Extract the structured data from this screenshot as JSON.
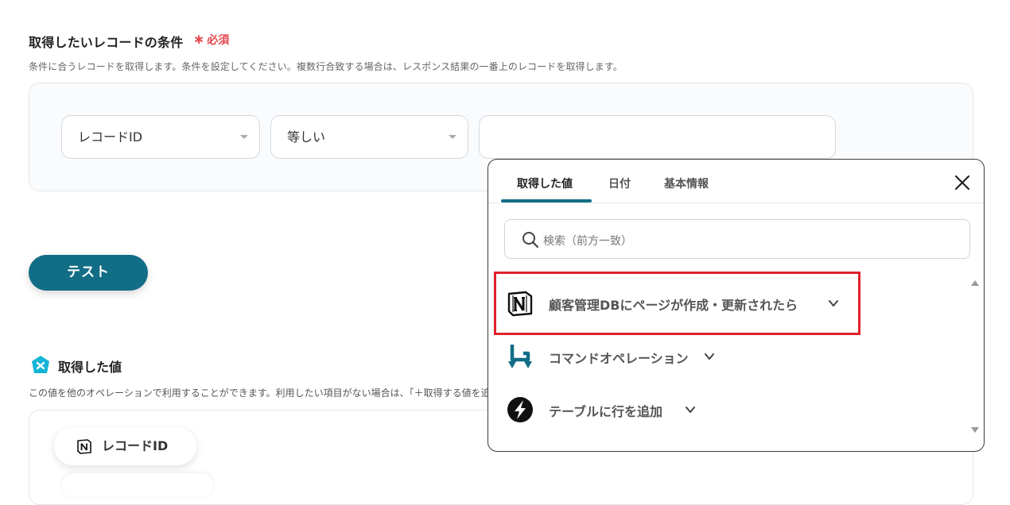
{
  "condition_section": {
    "title": "取得したいレコードの条件",
    "required_label": "必須",
    "description": "条件に合うレコードを取得します。条件を設定してください。複数行合致する場合は、レスポンス結果の一番上のレコードを取得します。",
    "field_select": "レコードID",
    "operator_select": "等しい",
    "value_input": ""
  },
  "test_button": "テスト",
  "value_section": {
    "title": "取得した値",
    "description": "この値を他のオペレーションで利用することができます。利用したい項目がない場合は、「＋取得する値を追加」から追加してください。",
    "chip_label": "レコードID"
  },
  "popup": {
    "tabs": [
      {
        "label": "取得した値",
        "active": true
      },
      {
        "label": "日付",
        "active": false
      },
      {
        "label": "基本情報",
        "active": false
      }
    ],
    "search_placeholder": "検索（前方一致）",
    "items": [
      {
        "label": "顧客管理DBにページが作成・更新されたら",
        "icon": "notion-icon",
        "highlighted": true
      },
      {
        "label": "コマンドオペレーション",
        "icon": "command-operation-icon",
        "highlighted": false
      },
      {
        "label": "テーブルに行を追加",
        "icon": "lightning-icon",
        "highlighted": false
      }
    ]
  },
  "colors": {
    "accent": "#126d86",
    "required": "#e5484d",
    "highlight": "#e0202a"
  }
}
